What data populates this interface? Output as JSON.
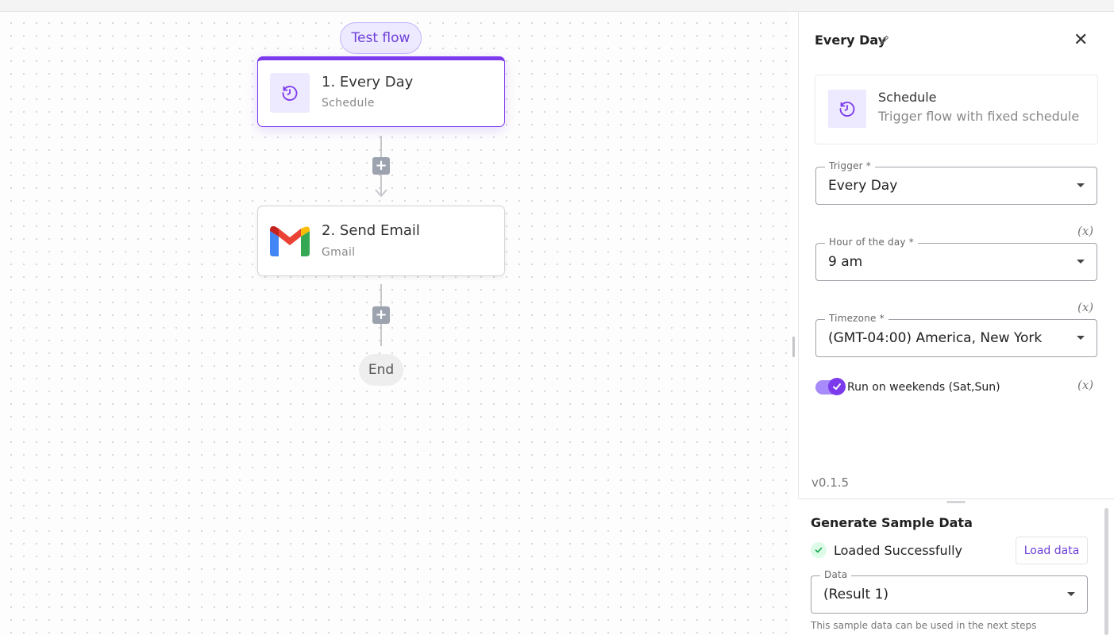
{
  "canvas": {
    "test_flow_label": "Test flow",
    "steps": [
      {
        "title": "1. Every Day",
        "subtitle": "Schedule",
        "icon": "clock-icon"
      },
      {
        "title": "2. Send Email",
        "subtitle": "Gmail",
        "icon": "gmail-icon"
      }
    ],
    "add_step_glyph": "+",
    "end_label": "End"
  },
  "panel": {
    "title": "Every Day",
    "close_glyph": "✕",
    "piece": {
      "name": "Schedule",
      "description": "Trigger flow with fixed schedule"
    },
    "fields": {
      "trigger": {
        "label": "Trigger *",
        "value": "Every Day"
      },
      "hour": {
        "label": "Hour of the day *",
        "value": "9 am"
      },
      "timezone": {
        "label": "Timezone *",
        "value": "(GMT-04:00) America, New York"
      }
    },
    "fx_label": "(x)",
    "weekends": {
      "label": "Run on weekends (Sat,Sun)",
      "checked": true
    },
    "version": "v0.1.5"
  },
  "sample": {
    "title": "Generate Sample Data",
    "status": "Loaded Successfully",
    "load_button": "Load data",
    "data_field": {
      "label": "Data",
      "value": "(Result 1)"
    },
    "help_text": "This sample data can be used in the next steps"
  },
  "colors": {
    "accent": "#7c3aed",
    "accent_light": "#ede9fe",
    "success": "#16a34a"
  }
}
